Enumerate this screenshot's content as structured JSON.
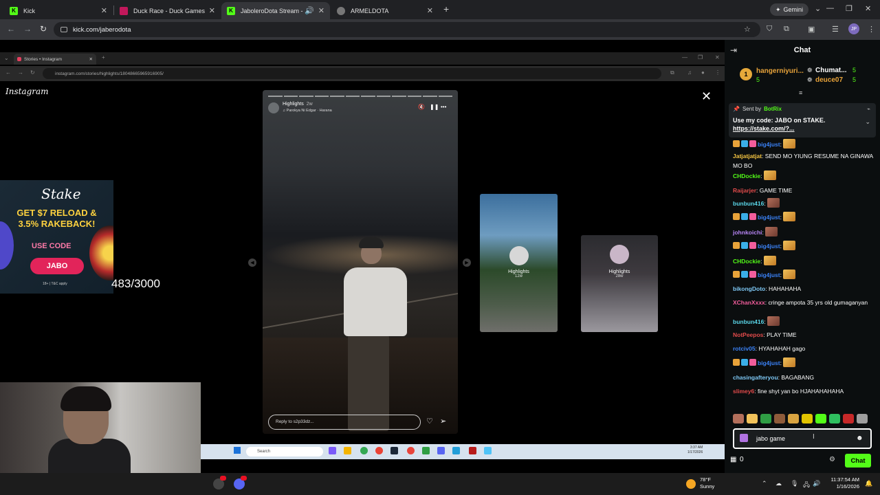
{
  "browser": {
    "tabs": [
      {
        "title": "Kick",
        "favicon": "K",
        "active": false
      },
      {
        "title": "Duck Race - Duck Games",
        "favicon": "",
        "active": false
      },
      {
        "title": "JaboleroDota Stream - Wat",
        "favicon": "K",
        "active": true
      },
      {
        "title": "ARMELDOTA",
        "favicon": "",
        "active": false
      }
    ],
    "gemini_label": "Gemini",
    "url": "kick.com/jaberodota",
    "profile_initials": "JP"
  },
  "stream": {
    "inner_tab_title": "Stories • Instagram",
    "inner_url": "instagram.com/stories/highlights/18048665965916905/",
    "instagram_logo": "Instagram",
    "story": {
      "title": "Highlights",
      "time": "2w",
      "song": "♫ Parokya Ni Edgar · Harana",
      "reply_placeholder": "Reply to s2p33dz..."
    },
    "side_stories": [
      {
        "label": "Highlights",
        "time": "12w"
      },
      {
        "label": "Highlights",
        "time": "28w"
      }
    ],
    "ad": {
      "logo": "Stake",
      "headline_1": "GET $7 RELOAD &",
      "headline_2": "3.5% RAKEBACK!",
      "use_code": "USE CODE",
      "code": "JABO",
      "fine_print": "18+ | T&C apply"
    },
    "counter": "483/3000",
    "inner_taskbar": {
      "search": "Search",
      "time": "3:37 AM",
      "date": "1/17/2026"
    }
  },
  "chat": {
    "title": "Chat",
    "leaderboard": {
      "rank": "1",
      "entries": [
        {
          "name": "hangerniyuri...",
          "count": "5"
        },
        {
          "name": "Chumat...",
          "count": "5"
        },
        {
          "name": "deuce07",
          "count": "5"
        }
      ]
    },
    "pinned": {
      "sent_by": "Sent by",
      "sender": "BotRix",
      "message": "Use my code: JABO on STAKE.",
      "link": "https://stake.com/?..."
    },
    "messages": [
      {
        "user": "big4just",
        "text": "",
        "color": "#3b82f6",
        "badges": true,
        "emote": "hand"
      },
      {
        "user": "Jatjatjatjat",
        "text": "SEND MO YIUNG RESUME NA GINAWA MO BO",
        "color": "#f5c542",
        "badges": false,
        "emote": ""
      },
      {
        "user": "CHDockie",
        "text": "",
        "color": "#53fc18",
        "badges": false,
        "emote": "hand"
      },
      {
        "user": "Raijarjer",
        "text": "GAME TIME",
        "color": "#e24b4b",
        "badges": false,
        "emote": ""
      },
      {
        "user": "bunbun416",
        "text": "",
        "color": "#5ad6e8",
        "badges": false,
        "emote": "face"
      },
      {
        "user": "big4just",
        "text": "",
        "color": "#3b82f6",
        "badges": true,
        "emote": "hand"
      },
      {
        "user": "johnkoichi",
        "text": "",
        "color": "#b785f5",
        "badges": false,
        "emote": "face"
      },
      {
        "user": "big4just",
        "text": "",
        "color": "#3b82f6",
        "badges": true,
        "emote": "hand"
      },
      {
        "user": "CHDockie",
        "text": "",
        "color": "#53fc18",
        "badges": false,
        "emote": "hand"
      },
      {
        "user": "big4just",
        "text": "",
        "color": "#3b82f6",
        "badges": true,
        "emote": "hand"
      },
      {
        "user": "bikongDoto",
        "text": "HAHAHAHA",
        "color": "#7ec8f5",
        "badges": false,
        "emote": ""
      },
      {
        "user": "XChanXxxx",
        "text": "cringe ampota 35 yrs old gumaganyan",
        "color": "#f25d9c",
        "badges": false,
        "emote": ""
      },
      {
        "user": "bunbun416",
        "text": "",
        "color": "#5ad6e8",
        "badges": false,
        "emote": "face"
      },
      {
        "user": "NotPeepos",
        "text": "PLAY TIME",
        "color": "#e24b4b",
        "badges": false,
        "emote": ""
      },
      {
        "user": "rotciv05",
        "text": "HYAHAHAH gago",
        "color": "#3b82f6",
        "badges": false,
        "emote": ""
      },
      {
        "user": "big4just",
        "text": "",
        "color": "#3b82f6",
        "badges": true,
        "emote": "hand"
      },
      {
        "user": "chasingafteryou",
        "text": "BAGABANG",
        "color": "#7ec8f5",
        "badges": false,
        "emote": ""
      },
      {
        "user": "slimey6",
        "text": "fine shyt yan bo HJAHAHAHAHA",
        "color": "#e24b4b",
        "badges": false,
        "emote": ""
      }
    ],
    "input_value": "jabo game",
    "viewer_count": "0",
    "send_label": "Chat"
  },
  "taskbar": {
    "temperature": "78°F",
    "weather": "Sunny",
    "time": "11:37:54 AM",
    "date": "1/16/2026"
  }
}
